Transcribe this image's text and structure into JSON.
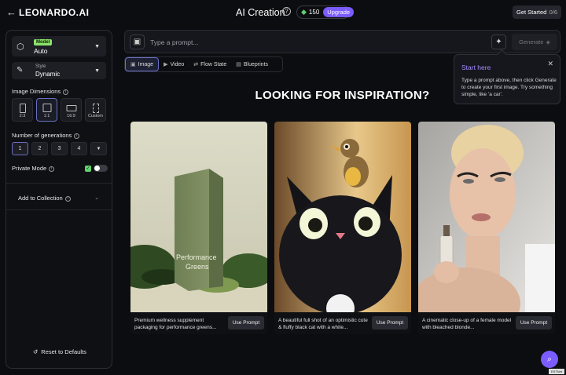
{
  "header": {
    "back_icon": "arrow-left-icon",
    "brand": "LEONARDO.AI",
    "title": "AI Creation",
    "help_icon": "question-circle-icon",
    "tokens": "150",
    "token_icon": "token-icon",
    "upgrade_label": "Upgrade",
    "get_started_label": "Get Started",
    "get_started_count": "0/6"
  },
  "sidebar": {
    "model": {
      "badge": "Model",
      "value": "Auto"
    },
    "style": {
      "label": "Style",
      "value": "Dynamic"
    },
    "image_dimensions_label": "Image Dimensions",
    "dimensions": [
      {
        "label": "2:3",
        "selected": false
      },
      {
        "label": "1:1",
        "selected": true
      },
      {
        "label": "16:9",
        "selected": false
      },
      {
        "label": "Custom",
        "selected": false
      }
    ],
    "generations_label": "Number of generations",
    "generations": [
      "1",
      "2",
      "3",
      "4"
    ],
    "generations_selected": "1",
    "private_mode_label": "Private Mode",
    "add_to_collection_label": "Add to Collection",
    "reset_label": "Reset to Defaults"
  },
  "prompt": {
    "placeholder": "Type a prompt...",
    "generate_label": "Generate"
  },
  "tabs": [
    {
      "label": "Image",
      "icon": "image-icon",
      "active": true
    },
    {
      "label": "Video",
      "icon": "video-icon",
      "active": false
    },
    {
      "label": "Flow State",
      "icon": "flow-icon",
      "active": false
    },
    {
      "label": "Blueprints",
      "icon": "blueprint-icon",
      "active": false
    }
  ],
  "popover": {
    "title": "Start here",
    "body": "Type a prompt above, then click Generate to create your first image. Try something simple, like 'a car'."
  },
  "inspiration": {
    "heading": "LOOKING FOR INSPIRATION?",
    "use_prompt_label": "Use Prompt",
    "cards": [
      {
        "caption": "Premium wellness supplement packaging for performance greens...",
        "package_text_1": "Performance",
        "package_text_2": "Greens"
      },
      {
        "caption": "A beautiful full shot of an optimistic cute & fluffy black cat with a white..."
      },
      {
        "caption": "A cinematic close-up of a female model with bleached blonde..."
      }
    ]
  },
  "footer": {
    "corner_tag": "ESTNet"
  },
  "colors": {
    "accent": "#7b5cff",
    "model_badge": "#8ce36b",
    "popover_title": "#a58bff"
  }
}
